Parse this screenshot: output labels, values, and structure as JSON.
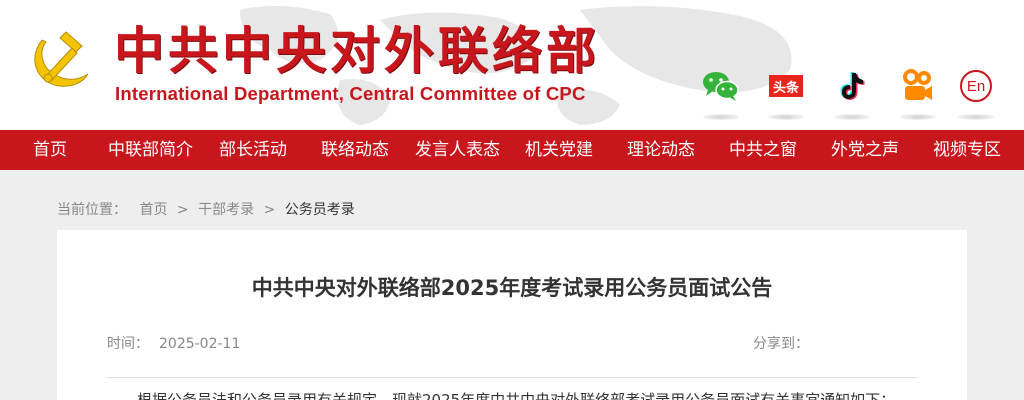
{
  "header": {
    "title": "中共中央对外联络部",
    "subtitle": "International Department, Central Committee of CPC",
    "social": [
      {
        "icon": "wechat-icon"
      },
      {
        "icon": "toutiao-icon",
        "label": "头条"
      },
      {
        "icon": "douyin-icon"
      },
      {
        "icon": "kuaishou-icon"
      },
      {
        "icon": "english-icon",
        "label": "En"
      }
    ],
    "colors": {
      "brand_red": "#c8161d",
      "emblem_gold": "#f5c400"
    }
  },
  "nav": {
    "items": [
      "首页",
      "中联部简介",
      "部长活动",
      "联络动态",
      "发言人表态",
      "机关党建",
      "理论动态",
      "中共之窗",
      "外党之声",
      "视频专区"
    ]
  },
  "breadcrumb": {
    "label": "当前位置：",
    "items": [
      "首页",
      "干部考录",
      "公务员考录"
    ],
    "separator": ">"
  },
  "article": {
    "title": "中共中央对外联络部2025年度考试录用公务员面试公告",
    "time_label": "时间：",
    "time": "2025-02-11",
    "share_label": "分享到：",
    "body_first_line": "根据公务员法和公务员录用有关规定，现就2025年度中共中央对外联络部考试录用公务员面试有关事宜通知如下："
  }
}
